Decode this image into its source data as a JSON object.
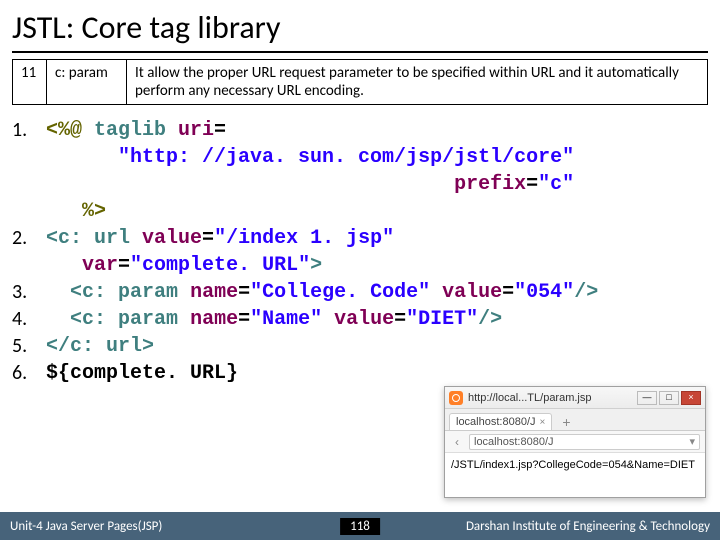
{
  "title": "JSTL: Core tag library",
  "deftable": {
    "num": "11",
    "tag": "c: param",
    "desc": "It allow the proper URL request parameter to be specified within URL and it automatically perform any necessary URL encoding."
  },
  "code": {
    "l1": {
      "no": "1.",
      "a": "<%@ ",
      "b": "taglib ",
      "c": "uri",
      "d": "="
    },
    "l1b": {
      "indent": "      ",
      "v": "\"http: //java. sun. com/jsp/jstl/core\""
    },
    "l1c": {
      "indent": "                                  ",
      "a": "prefix",
      "b": "=",
      "v": "\"c\""
    },
    "l1d": {
      "indent": "   ",
      "a": "%>"
    },
    "l2": {
      "no": "2.",
      "a": "<",
      "b": "c: url ",
      "c": "value",
      "d": "=",
      "v1": "\"/index 1. jsp\""
    },
    "l2b": {
      "indent": "   ",
      "a": "var",
      "b": "=",
      "v": "\"complete. URL\"",
      "c": ">"
    },
    "l3": {
      "no": "3.",
      "indent": "  ",
      "a": "<",
      "b": "c: param ",
      "c": "name",
      "d": "=",
      "v1": "\"College. Code\"",
      "e": " ",
      "f": "value",
      "g": "=",
      "v2": "\"054\"",
      "h": "/>"
    },
    "l4": {
      "no": "4.",
      "indent": "  ",
      "a": "<",
      "b": "c: param ",
      "c": "name",
      "d": "=",
      "v1": "\"Name\"",
      "e": " ",
      "f": "value",
      "g": "=",
      "v2": "\"DIET\"",
      "h": "/>"
    },
    "l5": {
      "no": "5.",
      "a": "</",
      "b": "c: url",
      "c": ">"
    },
    "l6": {
      "no": "6.",
      "a": "${complete. URL}"
    }
  },
  "browser": {
    "title": "http://local...TL/param.jsp",
    "winmin": "—",
    "winmax": "□",
    "winclose": "×",
    "tab_label": "localhost:8080/J",
    "tab_close": "×",
    "newtab": "+",
    "nav_back": "‹",
    "url_text": "localhost:8080/J",
    "url_dd": "▾",
    "content": "/JSTL/index1.jsp?CollegeCode=054&Name=DIET"
  },
  "footer": {
    "left": "Unit-4 Java Server Pages(JSP)",
    "page": "118",
    "right": "Darshan Institute of Engineering & Technology"
  }
}
